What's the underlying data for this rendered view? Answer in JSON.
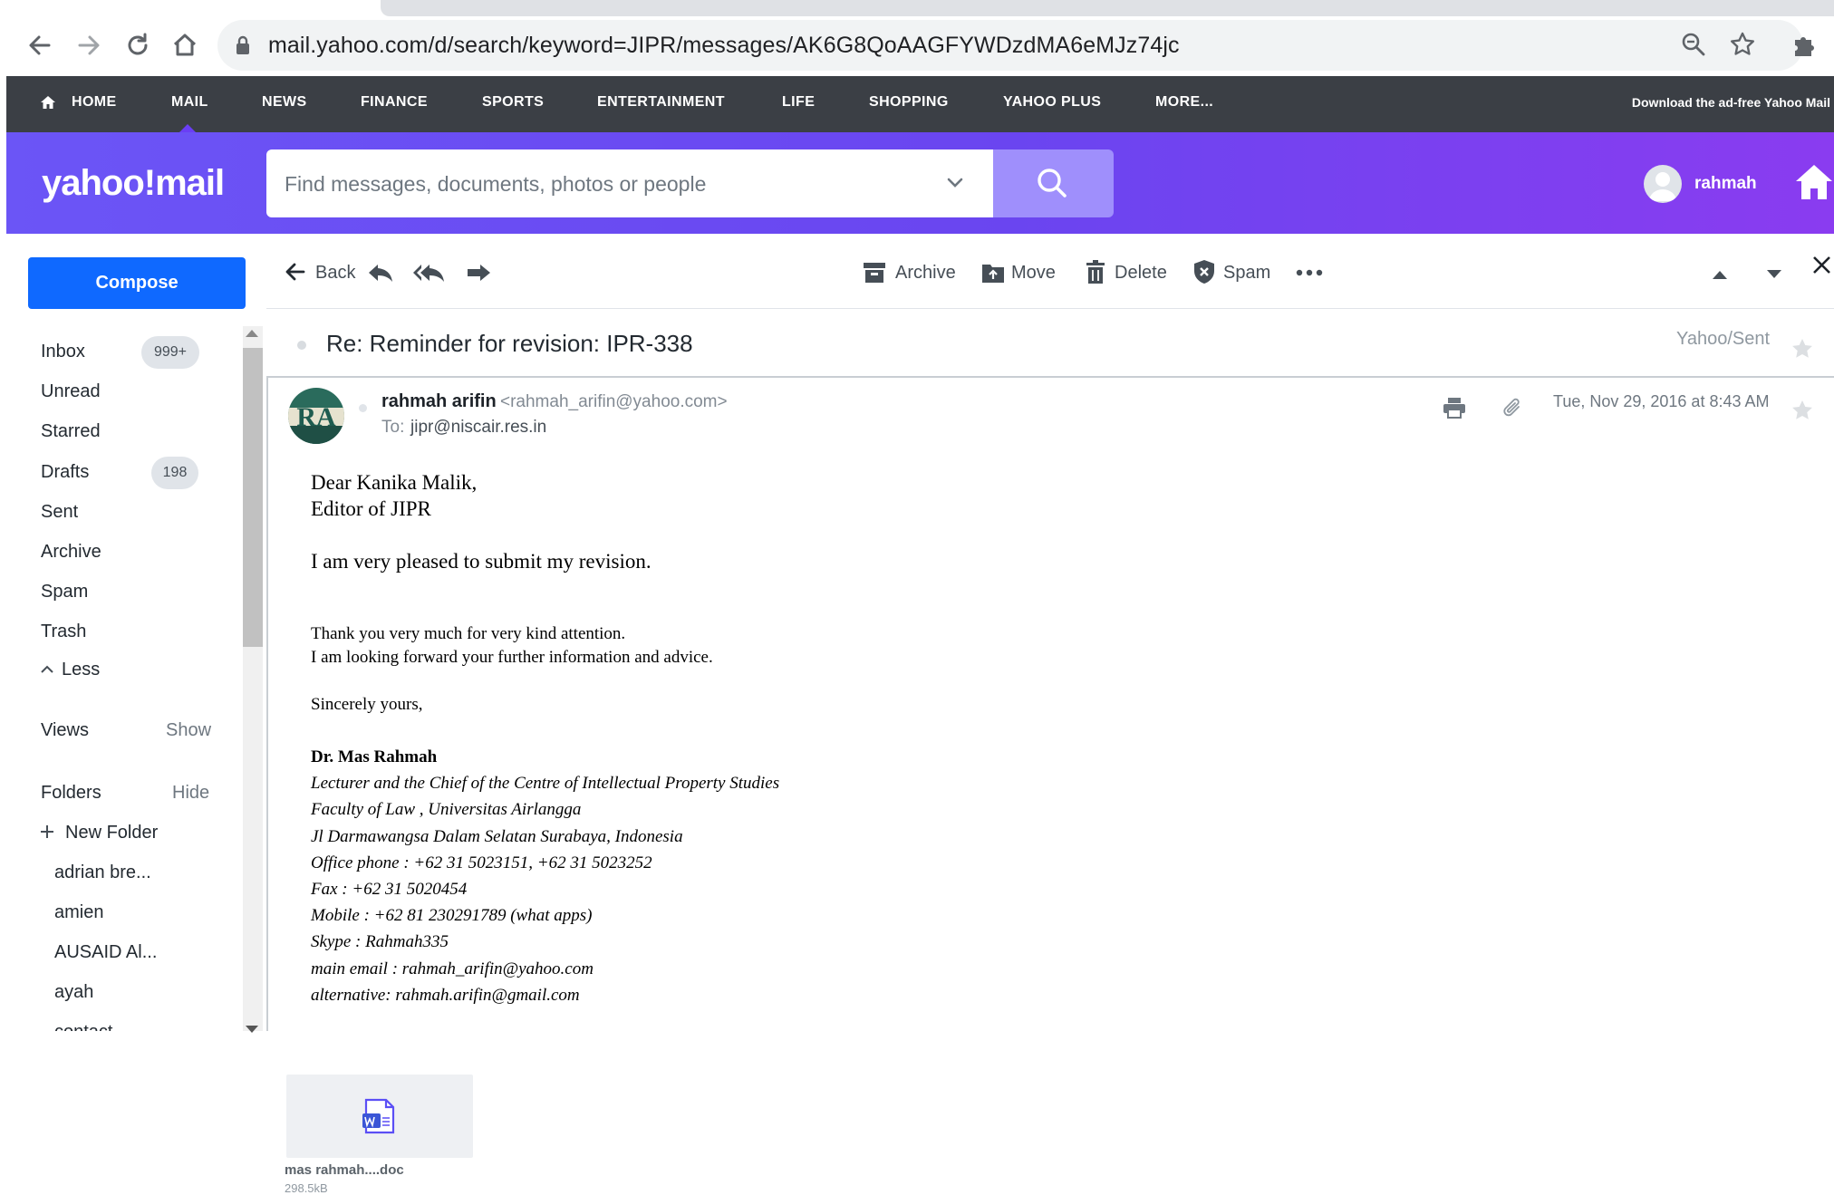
{
  "browser": {
    "url": "mail.yahoo.com/d/search/keyword=JIPR/messages/AK6G8QoAAGFYWDzdMA6eMJz74jc"
  },
  "topnav": {
    "items": [
      "HOME",
      "MAIL",
      "NEWS",
      "FINANCE",
      "SPORTS",
      "ENTERTAINMENT",
      "LIFE",
      "SHOPPING",
      "YAHOO PLUS",
      "MORE..."
    ],
    "adfree": "Download the ad-free Yahoo Mail"
  },
  "header": {
    "logo": "yahoo!mail",
    "search_placeholder": "Find messages, documents, photos or people",
    "username": "rahmah"
  },
  "sidebar": {
    "compose": "Compose",
    "folders": [
      {
        "label": "Inbox",
        "badge": "999+"
      },
      {
        "label": "Unread"
      },
      {
        "label": "Starred"
      },
      {
        "label": "Drafts",
        "badge": "198"
      },
      {
        "label": "Sent"
      },
      {
        "label": "Archive"
      },
      {
        "label": "Spam"
      },
      {
        "label": "Trash"
      }
    ],
    "less": "Less",
    "views": "Views",
    "views_toggle": "Show",
    "folders_heading": "Folders",
    "folders_toggle": "Hide",
    "new_folder": "New Folder",
    "user_folders": [
      "adrian bre...",
      "amien",
      "AUSAID Al...",
      "ayah",
      "contact"
    ]
  },
  "toolbar": {
    "back": "Back",
    "archive": "Archive",
    "move": "Move",
    "delete": "Delete",
    "spam": "Spam"
  },
  "message": {
    "subject": "Re: Reminder for revision: IPR-338",
    "folder": "Yahoo/Sent",
    "sender_initials": "RA",
    "sender_name": "rahmah arifin",
    "sender_email": "<rahmah_arifin@yahoo.com>",
    "to_label": "To:",
    "to": "jipr@niscair.res.in",
    "date": "Tue, Nov 29, 2016 at 8:43 AM",
    "body": {
      "greeting1": "Dear Kanika Malik,",
      "greeting2": "Editor of JIPR",
      "line1": "I am very pleased to submit my revision.",
      "line2": "Thank you  very much for very kind attention.",
      "line3": "I am looking forward your further information and  advice.",
      "closing": "Sincerely yours,",
      "sig_name": "Dr. Mas Rahmah",
      "sig_lines": [
        "Lecturer and the Chief of the Centre of Intellectual Property Studies",
        "Faculty of Law , Universitas Airlangga",
        "Jl Darmawangsa Dalam Selatan Surabaya, Indonesia",
        "Office phone :  +62 31 5023151,  +62 31 5023252",
        "Fax : +62 31 5020454",
        "Mobile : +62 81 230291789 (what apps)",
        "Skype : Rahmah335",
        "main email : rahmah_arifin@yahoo.com",
        "alternative: rahmah.arifin@gmail.com"
      ]
    }
  },
  "attachment": {
    "name": "mas rahmah....doc",
    "size": "298.5kB"
  },
  "colors": {
    "nav_bg": "#3b3f45",
    "header_purple": "#6b55f6",
    "compose_blue": "#0f69ff",
    "search_button": "#9f8ffc"
  }
}
